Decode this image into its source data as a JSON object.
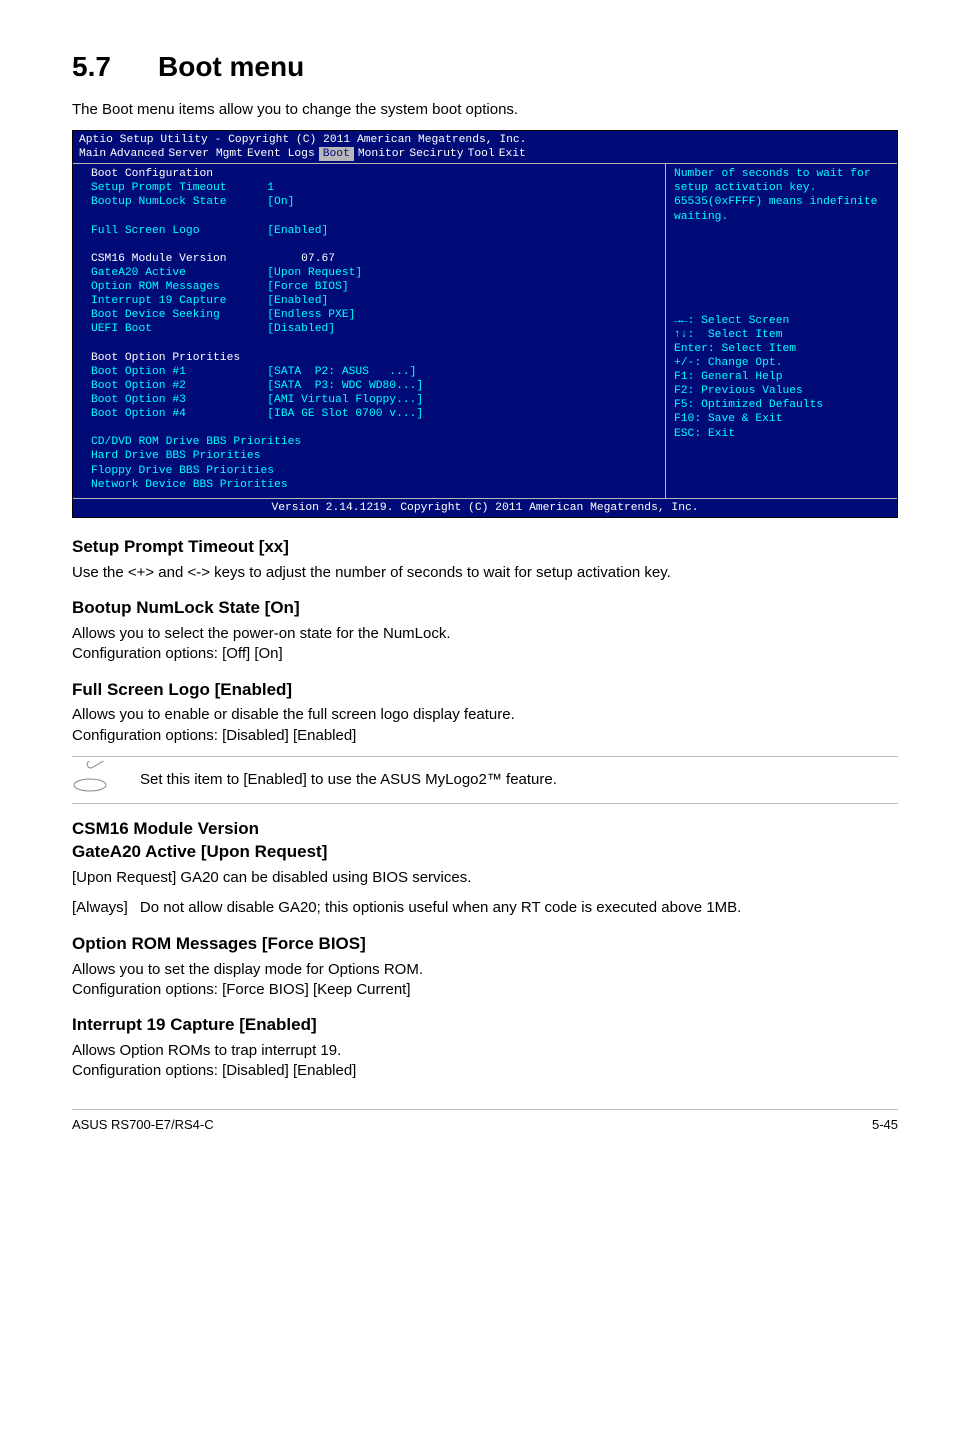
{
  "heading_number": "5.7",
  "heading_title": "Boot menu",
  "intro": "The Boot menu items allow you to change the system boot options.",
  "bios": {
    "title_line": "Aptio Setup Utility - Copyright (C) 2011 American Megatrends, Inc.",
    "menubar": [
      "Main",
      "Advanced",
      "Server Mgmt",
      "Event Logs",
      "Boot",
      "Monitor",
      "Seciruty",
      "Tool",
      "Exit"
    ],
    "left_block1_white": "Boot Configuration",
    "left_block1_cyan": "Setup Prompt Timeout      1\nBootup NumLock State      [On]\n\nFull Screen Logo          [Enabled]",
    "left_block2_white": "CSM16 Module Version           07.67",
    "left_block2_cyan": "GateA20 Active            [Upon Request]\nOption ROM Messages       [Force BIOS]\nInterrupt 19 Capture      [Enabled]\nBoot Device Seeking       [Endless PXE]\nUEFI Boot                 [Disabled]",
    "left_block3_white": "Boot Option Priorities",
    "left_block3_cyan": "Boot Option #1            [SATA  P2: ASUS   ...]\nBoot Option #2            [SATA  P3: WDC WD80...]\nBoot Option #3            [AMI Virtual Floppy...]\nBoot Option #4            [IBA GE Slot 0700 v...]\n\nCD/DVD ROM Drive BBS Priorities\nHard Drive BBS Priorities\nFloppy Drive BBS Priorities\nNetwork Device BBS Priorities",
    "right_help": "Number of seconds to wait for setup activation key. 65535(0xFFFF) means indefinite waiting.",
    "right_keys": "→←: Select Screen\n↑↓:  Select Item\nEnter: Select Item\n+/-: Change Opt.\nF1: General Help\nF2: Previous Values\nF5: Optimized Defaults\nF10: Save & Exit\nESC: Exit",
    "footer_line": "Version 2.14.1219. Copyright (C) 2011 American Megatrends, Inc."
  },
  "sections": {
    "s1_head": "Setup Prompt Timeout [xx]",
    "s1_body": "Use the <+> and <-> keys to adjust the number of seconds to wait for setup activation key.",
    "s2_head": "Bootup NumLock State [On]",
    "s2_body": "Allows you to select the power-on state for the NumLock.\nConfiguration options: [Off] [On]",
    "s3_head": "Full Screen Logo [Enabled]",
    "s3_body": "Allows you to enable or disable the full screen logo display feature.\nConfiguration options: [Disabled] [Enabled]",
    "note_text": "Set this item to [Enabled] to use the ASUS MyLogo2™ feature.",
    "s4_head1": "CSM16 Module Version",
    "s4_head2": "GateA20 Active [Upon Request]",
    "s4_line1": "[Upon Request] GA20 can be disabled using BIOS services.",
    "s4_term": "[Always]",
    "s4_def": "Do not allow disable GA20; this optionis useful when any RT code is executed above 1MB.",
    "s5_head": "Option ROM Messages [Force BIOS]",
    "s5_body": "Allows you to set the display mode for Options ROM.\nConfiguration options: [Force BIOS] [Keep Current]",
    "s6_head": "Interrupt 19 Capture [Enabled]",
    "s6_body": "Allows Option ROMs to trap interrupt 19.\nConfiguration options: [Disabled] [Enabled]"
  },
  "footer_left": "ASUS RS700-E7/RS4-C",
  "footer_right": "5-45"
}
